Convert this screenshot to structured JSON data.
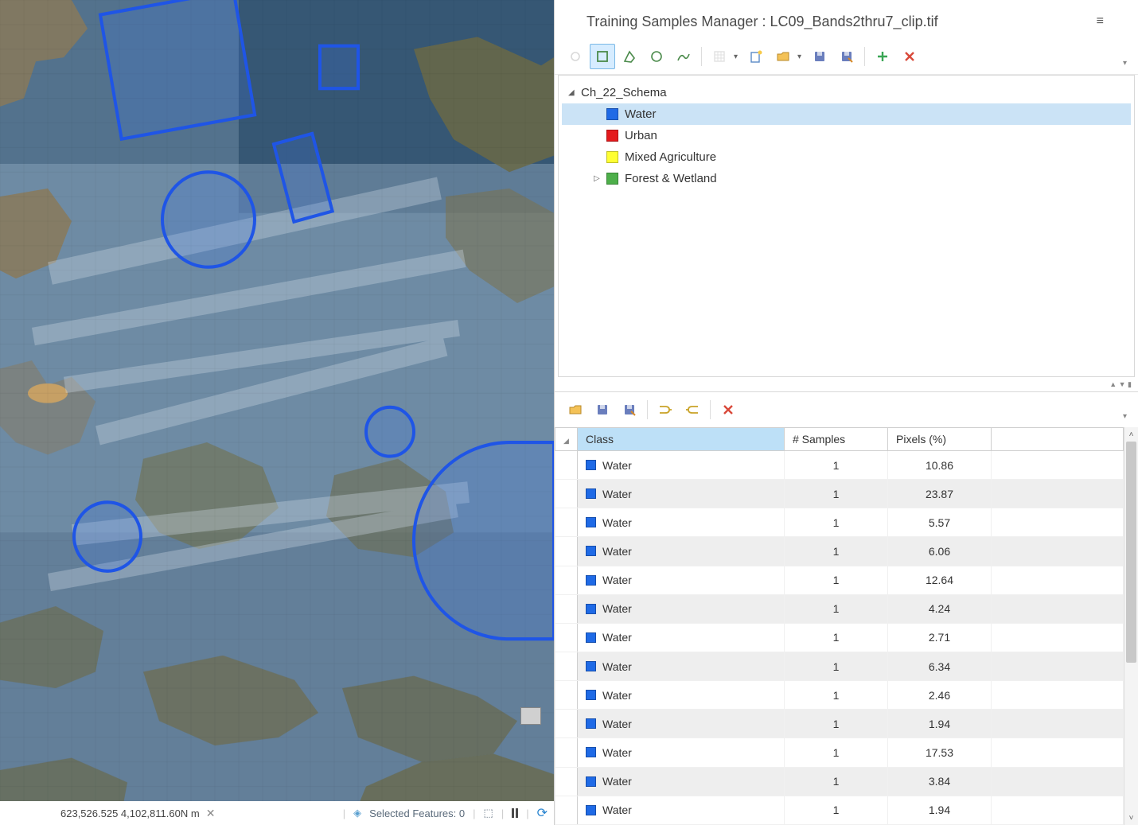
{
  "panel": {
    "title": "Training Samples Manager : LC09_Bands2thru7_clip.tif"
  },
  "toolbar1": {
    "tools": [
      "circle-disabled",
      "rectangle",
      "polygon",
      "circle",
      "freehand"
    ],
    "active": "rectangle"
  },
  "schema": {
    "root": "Ch_22_Schema",
    "classes": [
      {
        "name": "Water",
        "colorClass": "water-color",
        "selected": true,
        "caret": ""
      },
      {
        "name": "Urban",
        "colorClass": "urban-color",
        "selected": false,
        "caret": ""
      },
      {
        "name": "Mixed Agriculture",
        "colorClass": "agri-color",
        "selected": false,
        "caret": ""
      },
      {
        "name": "Forest & Wetland",
        "colorClass": "forest-color",
        "selected": false,
        "caret": "▷"
      }
    ]
  },
  "tableHeaders": {
    "class": "Class",
    "samples": "# Samples",
    "pixels": "Pixels (%)"
  },
  "samples": [
    {
      "class": "Water",
      "count": "1",
      "pixels": "10.86"
    },
    {
      "class": "Water",
      "count": "1",
      "pixels": "23.87"
    },
    {
      "class": "Water",
      "count": "1",
      "pixels": "5.57"
    },
    {
      "class": "Water",
      "count": "1",
      "pixels": "6.06"
    },
    {
      "class": "Water",
      "count": "1",
      "pixels": "12.64"
    },
    {
      "class": "Water",
      "count": "1",
      "pixels": "4.24"
    },
    {
      "class": "Water",
      "count": "1",
      "pixels": "2.71"
    },
    {
      "class": "Water",
      "count": "1",
      "pixels": "6.34"
    },
    {
      "class": "Water",
      "count": "1",
      "pixels": "2.46"
    },
    {
      "class": "Water",
      "count": "1",
      "pixels": "1.94"
    },
    {
      "class": "Water",
      "count": "1",
      "pixels": "17.53"
    },
    {
      "class": "Water",
      "count": "1",
      "pixels": "3.84"
    },
    {
      "class": "Water",
      "count": "1",
      "pixels": "1.94"
    }
  ],
  "status": {
    "coords": "623,526.525 4,102,811.60N m",
    "selected": "Selected Features: 0"
  }
}
